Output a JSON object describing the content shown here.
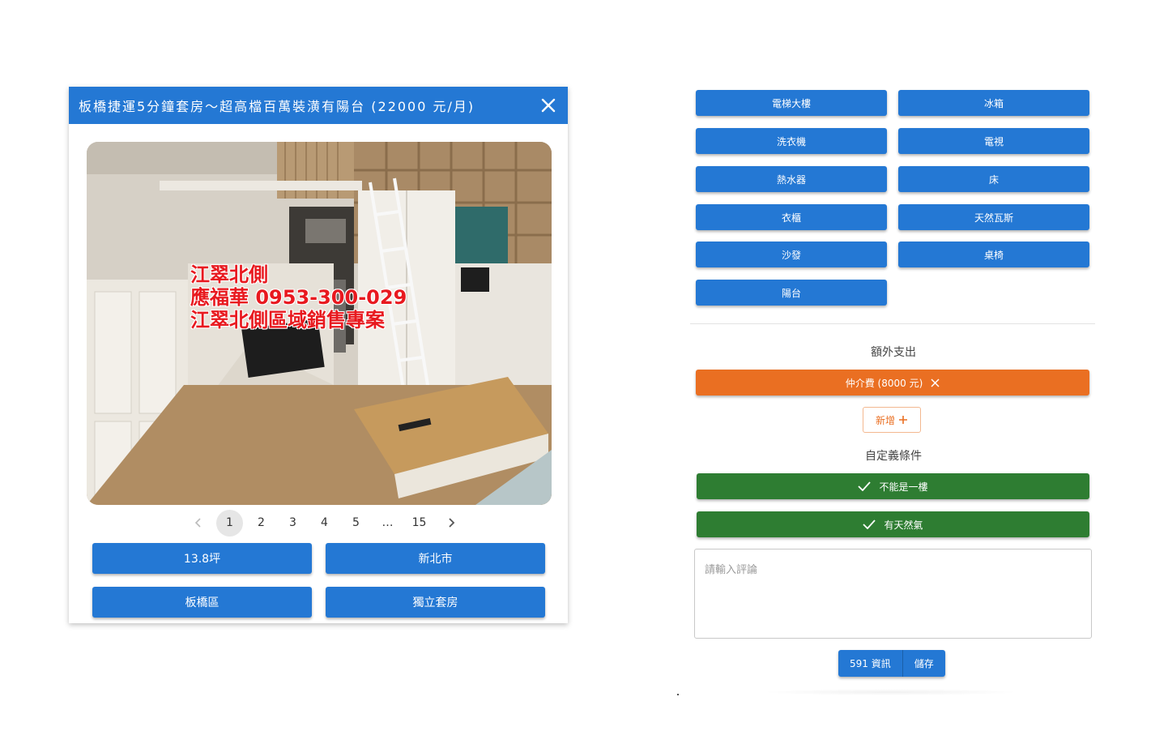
{
  "dialog": {
    "title": "板橋捷運5分鐘套房～超高檔百萬裝潢有陽台 (22000 元/月)",
    "photo": {
      "watermark_lines": [
        "江翠北側",
        "應福華 0953-300-029",
        "江翠北側區域銷售專案"
      ],
      "watermark_color": "#e8191f"
    },
    "pagination": {
      "pages": [
        "1",
        "2",
        "3",
        "4",
        "5",
        "…",
        "15"
      ],
      "current": "1"
    },
    "tags": [
      "13.8坪",
      "新北市",
      "板橋區",
      "獨立套房"
    ]
  },
  "features": [
    "電梯大樓",
    "冰箱",
    "洗衣機",
    "電視",
    "熱水器",
    "床",
    "衣櫃",
    "天然瓦斯",
    "沙發",
    "桌椅",
    "陽台"
  ],
  "extra_costs": {
    "heading": "額外支出",
    "items": [
      {
        "label": "仲介費 (8000 元)"
      }
    ],
    "add_label": "新增"
  },
  "custom_conditions": {
    "heading": "自定義條件",
    "items": [
      "不能是一樓",
      "有天然氣"
    ]
  },
  "comment": {
    "placeholder": "請輸入評論",
    "value": ""
  },
  "actions": {
    "info_label": "591 資訊",
    "save_label": "儲存"
  },
  "colors": {
    "primary": "#2478d4",
    "orange": "#ea6f22",
    "green": "#2e7d32"
  }
}
